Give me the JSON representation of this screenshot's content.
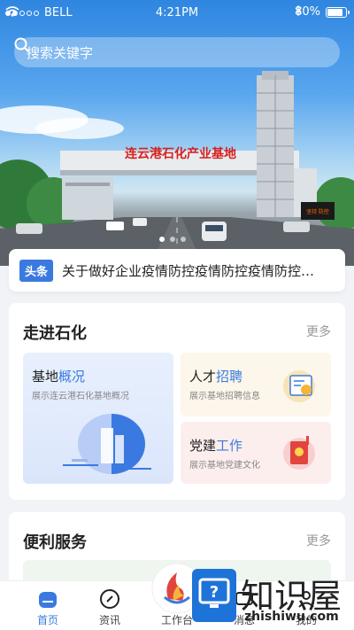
{
  "status": {
    "carrier": "BELL",
    "time": "4:21PM",
    "battery": "80%"
  },
  "search": {
    "placeholder": "搜索关键字"
  },
  "banner": {
    "sign": "连云港石化产业基地",
    "led": "坚持 防控 显示 创新"
  },
  "headline": {
    "tag": "头条",
    "text": "关于做好企业疫情防控疫情防控疫情防控…"
  },
  "section1": {
    "title": "走进石化",
    "more": "更多",
    "tiles": [
      {
        "t1": "基地",
        "t2": "概况",
        "desc": "展示连云港石化基地概况"
      },
      {
        "t1": "人才",
        "t2": "招聘",
        "desc": "展示基地招聘信息"
      },
      {
        "t1": "党建",
        "t2": "工作",
        "desc": "展示基地党建文化"
      }
    ]
  },
  "section2": {
    "title": "便利服务",
    "more": "更多"
  },
  "tabs": [
    {
      "label": "首页",
      "icon": "home-icon"
    },
    {
      "label": "资讯",
      "icon": "compass-icon"
    },
    {
      "label": "工作台",
      "icon": "workbench-icon"
    },
    {
      "label": "消息",
      "icon": "message-icon"
    },
    {
      "label": "我的",
      "icon": "profile-icon"
    }
  ],
  "watermark": {
    "name": "知识屋",
    "url": "zhishiwu.com"
  },
  "colors": {
    "accent": "#3a7ae0"
  }
}
